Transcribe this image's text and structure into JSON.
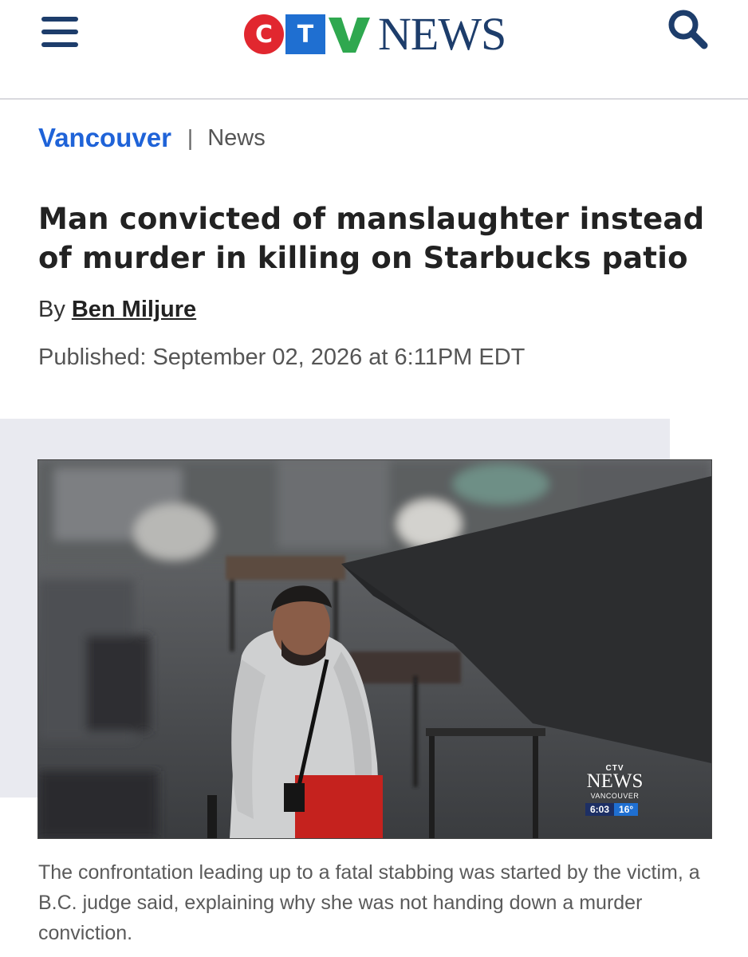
{
  "header": {
    "menu_icon": "hamburger-menu-icon",
    "logo": {
      "c": "C",
      "t": "T",
      "v": "V",
      "news": "NEWS",
      "colors": {
        "c": "#e1272f",
        "t": "#1f6fd1",
        "v": "#2fa84f",
        "news": "#1d3d6b"
      }
    },
    "search_icon": "search-icon"
  },
  "breadcrumb": {
    "section": "Vancouver",
    "separator": "|",
    "category": "News"
  },
  "article": {
    "headline": "Man convicted of manslaughter instead of murder in killing on Starbucks patio",
    "byline_prefix": "By",
    "author": "Ben Miljure",
    "published_label": "Published:",
    "published_date": "September 02, 2026 at 6:11PM EDT"
  },
  "media": {
    "watermark": {
      "ctv": "CTV",
      "news": "NEWS",
      "city": "VANCOUVER",
      "time": "6:03",
      "temp": "16°"
    },
    "caption": "The confrontation leading up to a fatal stabbing was started by the victim, a B.C. judge said, explaining why she was not handing down a murder conviction."
  },
  "colors": {
    "accent_blue": "#1f63d8",
    "navy": "#1d3d6b",
    "media_bg": "#e9eaf0"
  }
}
